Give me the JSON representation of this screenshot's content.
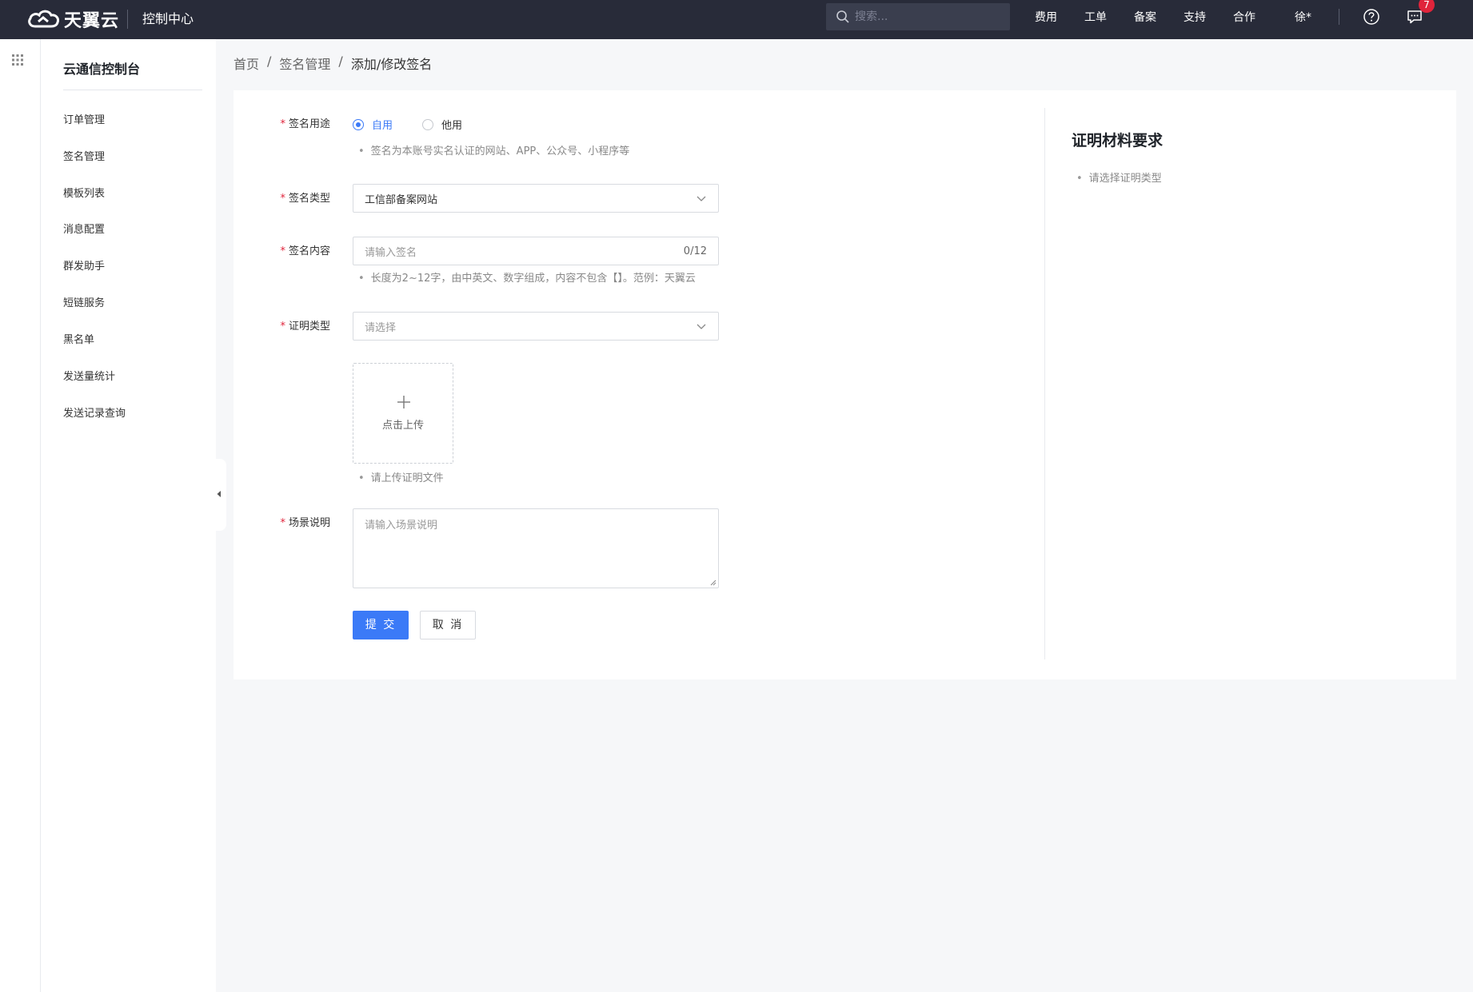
{
  "header": {
    "brand": "天翼云",
    "console_title": "控制中心",
    "search_placeholder": "搜索...",
    "nav": [
      "费用",
      "工单",
      "备案",
      "支持",
      "合作",
      "徐*"
    ],
    "message_badge": "7"
  },
  "sidebar": {
    "title": "云通信控制台",
    "items": [
      "订单管理",
      "签名管理",
      "模板列表",
      "消息配置",
      "群发助手",
      "短链服务",
      "黑名单",
      "发送量统计",
      "发送记录查询"
    ]
  },
  "breadcrumb": {
    "home": "首页",
    "sep": "/",
    "parent": "签名管理",
    "current": "添加/修改签名"
  },
  "form": {
    "usage": {
      "label": "签名用途",
      "options": [
        "自用",
        "他用"
      ],
      "selected": "自用",
      "hint": "签名为本账号实名认证的网站、APP、公众号、小程序等"
    },
    "type": {
      "label": "签名类型",
      "value": "工信部备案网站"
    },
    "content": {
      "label": "签名内容",
      "placeholder": "请输入签名",
      "counter": "0/12",
      "hint": "长度为2~12字，由中英文、数字组成，内容不包含【】。范例：天翼云"
    },
    "proof": {
      "label": "证明类型",
      "placeholder": "请选择"
    },
    "upload": {
      "label": "点击上传",
      "hint": "请上传证明文件"
    },
    "scene": {
      "label": "场景说明",
      "placeholder": "请输入场景说明"
    },
    "submit": "提 交",
    "cancel": "取 消"
  },
  "requirements": {
    "title": "证明材料要求",
    "item": "请选择证明类型"
  },
  "colors": {
    "topbar": "#282b39",
    "primary": "#3b7af7",
    "required": "#e0243b"
  }
}
